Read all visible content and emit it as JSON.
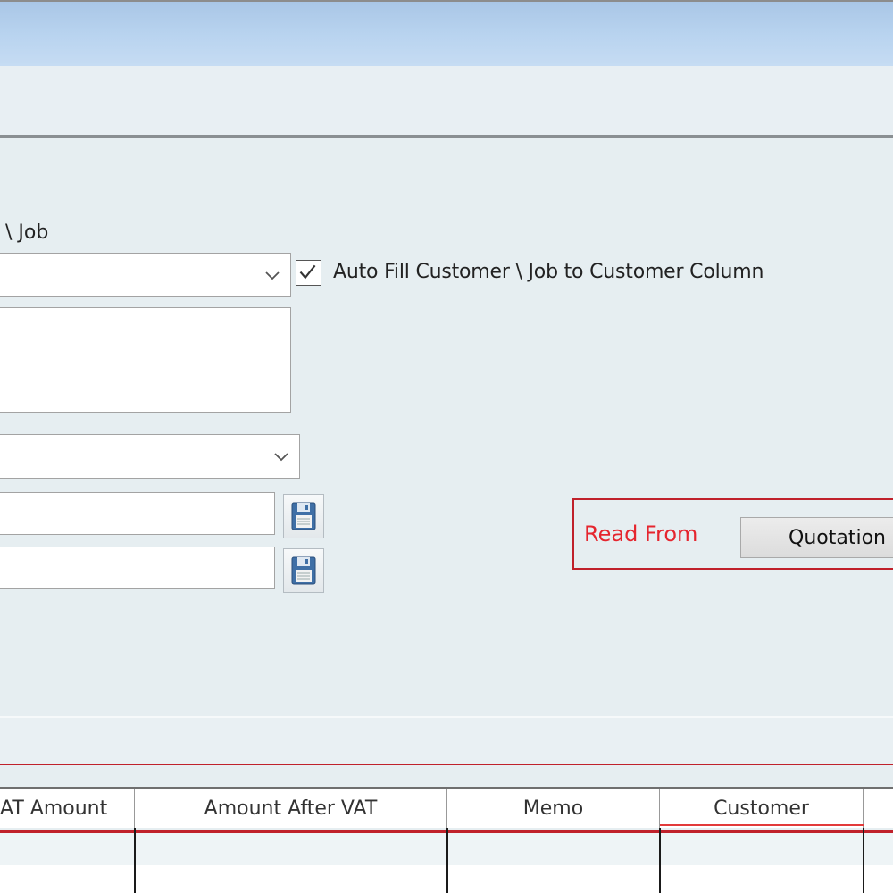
{
  "form": {
    "customer_job_label": "\\ Job",
    "auto_fill_checkbox": {
      "label": "Auto Fill Customer \\ Job to Customer Column",
      "checked": true
    }
  },
  "read_from": {
    "label": "Read From",
    "quotation_button": "Quotation"
  },
  "table": {
    "columns": [
      "AT Amount",
      "Amount After VAT",
      "Memo",
      "Customer"
    ]
  },
  "colors": {
    "highlight_red": "#c0212b",
    "label_red": "#e5252e",
    "titlebar_blue": "#b8d3ef"
  }
}
